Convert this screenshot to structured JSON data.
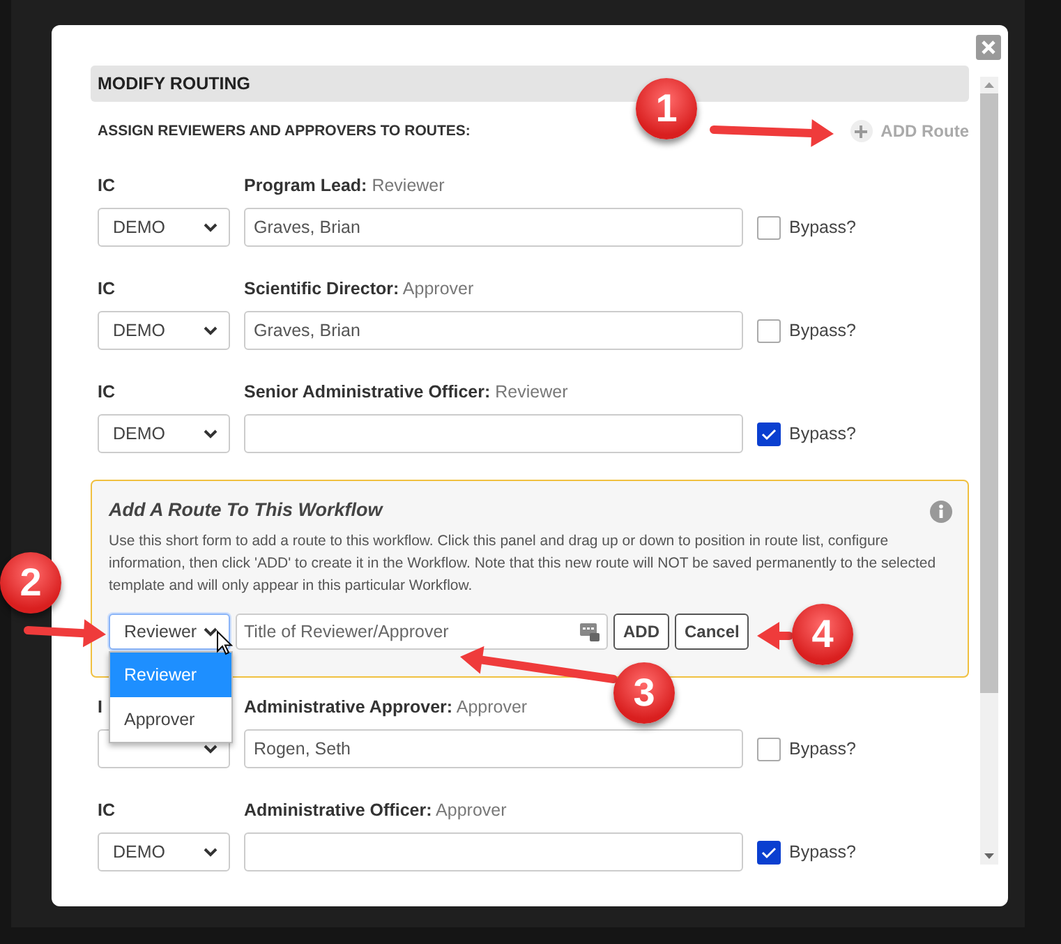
{
  "dialog": {
    "title": "MODIFY ROUTING",
    "subtitle": "ASSIGN REVIEWERS AND APPROVERS TO ROUTES:",
    "add_route": "ADD Route"
  },
  "routes_before": [
    {
      "ic_label": "IC",
      "ic_value": "DEMO",
      "role": "**Program Lead:** Reviewer",
      "assignee": "Graves, Brian",
      "bypass": false,
      "bypass_label": "Bypass?"
    },
    {
      "ic_label": "IC",
      "ic_value": "DEMO",
      "role": "**Scientific Director:** Approver",
      "assignee": "Graves, Brian",
      "bypass": false,
      "bypass_label": "Bypass?"
    },
    {
      "ic_label": "IC",
      "ic_value": "DEMO",
      "role": "**Senior Administrative Officer:** Reviewer",
      "bypass": true,
      "bypass_label": "Bypass?"
    }
  ],
  "add_form": {
    "title": "Add A Route To This Workflow",
    "description": "Use this short form to add a route to this workflow. Click this panel and drag up or down to position in route list, configure information, then click 'ADD' to create it in the Workflow. Note that this new route will NOT be saved permanently to the selected template and will only appear in this particular Workflow.",
    "role_select": {
      "value": "Reviewer",
      "options": [
        {
          "label": "Reviewer",
          "selected": true
        },
        {
          "label": "Approver",
          "selected": false
        }
      ]
    },
    "title_field": {
      "placeholder": "Title of Reviewer/Approver"
    },
    "buttons": [
      "ADD",
      "Cancel"
    ]
  },
  "routes_after": [
    {
      "ic_label": "I",
      "role": "**Administrative Approver:** Approver",
      "assignee": "Rogen, Seth",
      "bypass": false,
      "bypass_label": "Bypass?"
    },
    {
      "ic_label": "IC",
      "ic_value": "DEMO",
      "role": "**Administrative Officer:** Approver",
      "bypass": true,
      "bypass_label": "Bypass?"
    }
  ],
  "callouts": [
    {
      "label": "1"
    },
    {
      "label": "2"
    },
    {
      "label": "3"
    },
    {
      "label": "4"
    }
  ]
}
